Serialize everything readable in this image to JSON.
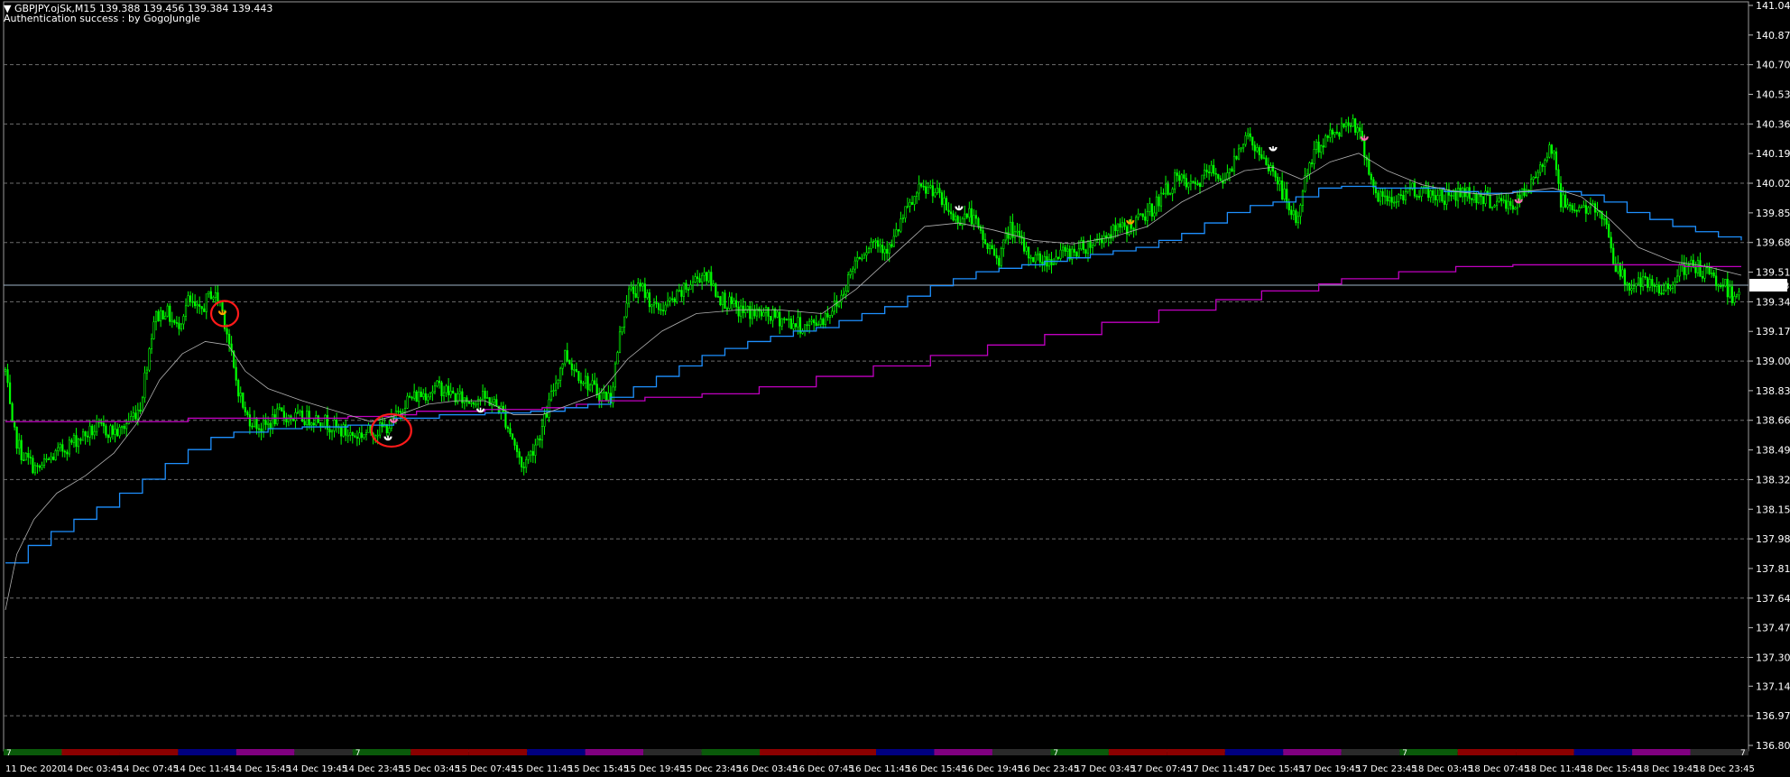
{
  "header": {
    "symbol_line": "GBPJPY.ojSk,M15  139.388 139.456 139.384 139.443",
    "status_line": "Authentication success : by GogoJungle"
  },
  "colors": {
    "background": "#000000",
    "grid": "#6e6e6e",
    "candles": "#00ff00",
    "blue_line": "#1e90ff",
    "magenta_line": "#c000c0",
    "ma_line": "#b0b0b0",
    "current_price_line": "#9fb3c8",
    "highlight_circle": "#ff1a1a"
  },
  "chart_data": {
    "type": "candlestick",
    "symbol": "GBPJPY.ojSk",
    "timeframe": "M15",
    "ylim": [
      136.803,
      141.048
    ],
    "y_ticks": [
      "141.048",
      "140.878",
      "140.708",
      "140.538",
      "140.368",
      "140.198",
      "140.028",
      "139.858",
      "139.688",
      "139.518",
      "139.348",
      "139.178",
      "139.008",
      "138.838",
      "138.668",
      "138.498",
      "138.328",
      "138.158",
      "137.988",
      "137.818",
      "137.648",
      "137.478",
      "137.308",
      "137.143",
      "136.973",
      "136.803"
    ],
    "current_price": "139.443",
    "ohlc_last": {
      "open": 139.388,
      "high": 139.456,
      "low": 139.384,
      "close": 139.443
    },
    "x_ticks": [
      "11 Dec 2020",
      "14 Dec 03:45",
      "14 Dec 07:45",
      "14 Dec 11:45",
      "14 Dec 15:45",
      "14 Dec 19:45",
      "14 Dec 23:45",
      "15 Dec 03:45",
      "15 Dec 07:45",
      "15 Dec 11:45",
      "15 Dec 15:45",
      "15 Dec 19:45",
      "15 Dec 23:45",
      "16 Dec 03:45",
      "16 Dec 07:45",
      "16 Dec 11:45",
      "16 Dec 15:45",
      "16 Dec 19:45",
      "16 Dec 23:45",
      "17 Dec 03:45",
      "17 Dec 07:45",
      "17 Dec 11:45",
      "17 Dec 15:45",
      "17 Dec 19:45",
      "17 Dec 23:45",
      "18 Dec 03:45",
      "18 Dec 07:45",
      "18 Dec 11:45",
      "18 Dec 15:45",
      "18 Dec 19:45",
      "18 Dec 23:45"
    ],
    "price_path": [
      [
        0,
        138.95
      ],
      [
        6,
        138.62
      ],
      [
        14,
        138.48
      ],
      [
        28,
        138.38
      ],
      [
        40,
        138.45
      ],
      [
        60,
        138.55
      ],
      [
        80,
        138.62
      ],
      [
        100,
        138.6
      ],
      [
        118,
        138.75
      ],
      [
        130,
        139.25
      ],
      [
        140,
        139.3
      ],
      [
        150,
        139.2
      ],
      [
        160,
        139.35
      ],
      [
        170,
        139.28
      ],
      [
        180,
        139.4
      ],
      [
        188,
        139.35
      ],
      [
        194,
        139.18
      ],
      [
        200,
        138.95
      ],
      [
        210,
        138.7
      ],
      [
        225,
        138.62
      ],
      [
        240,
        138.7
      ],
      [
        255,
        138.68
      ],
      [
        275,
        138.68
      ],
      [
        290,
        138.62
      ],
      [
        305,
        138.58
      ],
      [
        318,
        138.6
      ],
      [
        330,
        138.62
      ],
      [
        340,
        138.66
      ],
      [
        350,
        138.78
      ],
      [
        365,
        138.82
      ],
      [
        380,
        138.86
      ],
      [
        395,
        138.8
      ],
      [
        405,
        138.78
      ],
      [
        415,
        138.8
      ],
      [
        425,
        138.78
      ],
      [
        435,
        138.72
      ],
      [
        445,
        138.55
      ],
      [
        452,
        138.4
      ],
      [
        460,
        138.48
      ],
      [
        470,
        138.62
      ],
      [
        480,
        138.85
      ],
      [
        490,
        139.05
      ],
      [
        500,
        138.95
      ],
      [
        510,
        138.88
      ],
      [
        520,
        138.82
      ],
      [
        530,
        138.8
      ],
      [
        538,
        139.15
      ],
      [
        545,
        139.4
      ],
      [
        558,
        139.42
      ],
      [
        570,
        139.3
      ],
      [
        585,
        139.35
      ],
      [
        600,
        139.45
      ],
      [
        612,
        139.52
      ],
      [
        625,
        139.38
      ],
      [
        640,
        139.3
      ],
      [
        660,
        139.28
      ],
      [
        680,
        139.25
      ],
      [
        700,
        139.2
      ],
      [
        715,
        139.25
      ],
      [
        730,
        139.35
      ],
      [
        745,
        139.6
      ],
      [
        760,
        139.7
      ],
      [
        775,
        139.65
      ],
      [
        785,
        139.82
      ],
      [
        800,
        139.98
      ],
      [
        812,
        140.0
      ],
      [
        822,
        139.9
      ],
      [
        832,
        139.82
      ],
      [
        845,
        139.85
      ],
      [
        858,
        139.68
      ],
      [
        870,
        139.6
      ],
      [
        880,
        139.78
      ],
      [
        895,
        139.62
      ],
      [
        910,
        139.58
      ],
      [
        925,
        139.62
      ],
      [
        940,
        139.65
      ],
      [
        955,
        139.7
      ],
      [
        970,
        139.75
      ],
      [
        985,
        139.78
      ],
      [
        1000,
        139.85
      ],
      [
        1012,
        139.95
      ],
      [
        1025,
        140.05
      ],
      [
        1040,
        140.0
      ],
      [
        1055,
        140.1
      ],
      [
        1070,
        140.05
      ],
      [
        1080,
        140.25
      ],
      [
        1090,
        140.3
      ],
      [
        1100,
        140.15
      ],
      [
        1110,
        140.1
      ],
      [
        1120,
        139.95
      ],
      [
        1130,
        139.8
      ],
      [
        1140,
        140.1
      ],
      [
        1150,
        140.25
      ],
      [
        1160,
        140.3
      ],
      [
        1170,
        140.35
      ],
      [
        1180,
        140.4
      ],
      [
        1190,
        140.22
      ],
      [
        1200,
        139.95
      ],
      [
        1215,
        139.92
      ],
      [
        1230,
        140.0
      ],
      [
        1245,
        139.98
      ],
      [
        1260,
        139.95
      ],
      [
        1275,
        139.98
      ],
      [
        1290,
        139.95
      ],
      [
        1305,
        139.92
      ],
      [
        1320,
        139.9
      ],
      [
        1335,
        140.0
      ],
      [
        1345,
        140.15
      ],
      [
        1355,
        140.25
      ],
      [
        1362,
        139.92
      ],
      [
        1372,
        139.9
      ],
      [
        1385,
        139.88
      ],
      [
        1400,
        139.85
      ],
      [
        1410,
        139.55
      ],
      [
        1420,
        139.45
      ],
      [
        1435,
        139.45
      ],
      [
        1450,
        139.4
      ],
      [
        1465,
        139.52
      ],
      [
        1480,
        139.55
      ],
      [
        1495,
        139.48
      ],
      [
        1505,
        139.45
      ],
      [
        1512,
        139.38
      ],
      [
        1520,
        139.44
      ]
    ],
    "ma_path": [
      [
        0,
        137.58
      ],
      [
        10,
        137.9
      ],
      [
        25,
        138.1
      ],
      [
        45,
        138.25
      ],
      [
        70,
        138.35
      ],
      [
        95,
        138.48
      ],
      [
        115,
        138.65
      ],
      [
        135,
        138.9
      ],
      [
        155,
        139.05
      ],
      [
        175,
        139.12
      ],
      [
        195,
        139.1
      ],
      [
        210,
        138.95
      ],
      [
        230,
        138.85
      ],
      [
        260,
        138.78
      ],
      [
        290,
        138.72
      ],
      [
        320,
        138.66
      ],
      [
        345,
        138.7
      ],
      [
        370,
        138.76
      ],
      [
        395,
        138.78
      ],
      [
        420,
        138.78
      ],
      [
        445,
        138.7
      ],
      [
        470,
        138.7
      ],
      [
        495,
        138.76
      ],
      [
        520,
        138.82
      ],
      [
        545,
        139.02
      ],
      [
        575,
        139.18
      ],
      [
        605,
        139.28
      ],
      [
        640,
        139.3
      ],
      [
        680,
        139.3
      ],
      [
        715,
        139.28
      ],
      [
        745,
        139.42
      ],
      [
        775,
        139.6
      ],
      [
        805,
        139.78
      ],
      [
        835,
        139.8
      ],
      [
        865,
        139.76
      ],
      [
        900,
        139.7
      ],
      [
        935,
        139.68
      ],
      [
        970,
        139.72
      ],
      [
        1000,
        139.78
      ],
      [
        1030,
        139.92
      ],
      [
        1060,
        140.02
      ],
      [
        1085,
        140.1
      ],
      [
        1110,
        140.12
      ],
      [
        1135,
        140.05
      ],
      [
        1160,
        140.15
      ],
      [
        1185,
        140.2
      ],
      [
        1210,
        140.1
      ],
      [
        1240,
        140.02
      ],
      [
        1270,
        139.98
      ],
      [
        1300,
        139.96
      ],
      [
        1330,
        139.98
      ],
      [
        1355,
        140.0
      ],
      [
        1380,
        139.95
      ],
      [
        1405,
        139.82
      ],
      [
        1430,
        139.66
      ],
      [
        1460,
        139.58
      ],
      [
        1490,
        139.55
      ],
      [
        1520,
        139.5
      ]
    ],
    "blue_steps": [
      [
        0,
        137.85
      ],
      [
        20,
        137.95
      ],
      [
        40,
        138.03
      ],
      [
        60,
        138.1
      ],
      [
        80,
        138.17
      ],
      [
        100,
        138.25
      ],
      [
        120,
        138.33
      ],
      [
        140,
        138.42
      ],
      [
        160,
        138.5
      ],
      [
        180,
        138.57
      ],
      [
        200,
        138.6
      ],
      [
        230,
        138.62
      ],
      [
        260,
        138.63
      ],
      [
        300,
        138.64
      ],
      [
        340,
        138.68
      ],
      [
        380,
        138.7
      ],
      [
        420,
        138.71
      ],
      [
        460,
        138.72
      ],
      [
        490,
        138.74
      ],
      [
        510,
        138.76
      ],
      [
        530,
        138.8
      ],
      [
        550,
        138.86
      ],
      [
        570,
        138.92
      ],
      [
        590,
        138.98
      ],
      [
        610,
        139.04
      ],
      [
        630,
        139.08
      ],
      [
        650,
        139.12
      ],
      [
        670,
        139.15
      ],
      [
        690,
        139.18
      ],
      [
        710,
        139.2
      ],
      [
        730,
        139.24
      ],
      [
        750,
        139.28
      ],
      [
        770,
        139.32
      ],
      [
        790,
        139.38
      ],
      [
        810,
        139.44
      ],
      [
        830,
        139.48
      ],
      [
        850,
        139.52
      ],
      [
        870,
        139.54
      ],
      [
        890,
        139.56
      ],
      [
        910,
        139.58
      ],
      [
        930,
        139.6
      ],
      [
        950,
        139.62
      ],
      [
        970,
        139.64
      ],
      [
        990,
        139.66
      ],
      [
        1010,
        139.7
      ],
      [
        1030,
        139.74
      ],
      [
        1050,
        139.8
      ],
      [
        1070,
        139.86
      ],
      [
        1090,
        139.9
      ],
      [
        1110,
        139.92
      ],
      [
        1130,
        139.95
      ],
      [
        1150,
        140.0
      ],
      [
        1170,
        140.01
      ],
      [
        1200,
        140.0
      ],
      [
        1230,
        140.0
      ],
      [
        1260,
        139.98
      ],
      [
        1290,
        139.97
      ],
      [
        1320,
        139.98
      ],
      [
        1350,
        139.98
      ],
      [
        1380,
        139.96
      ],
      [
        1400,
        139.92
      ],
      [
        1420,
        139.86
      ],
      [
        1440,
        139.82
      ],
      [
        1460,
        139.78
      ],
      [
        1480,
        139.75
      ],
      [
        1500,
        139.72
      ],
      [
        1520,
        139.7
      ]
    ],
    "magenta_steps": [
      [
        0,
        138.66
      ],
      [
        100,
        138.66
      ],
      [
        160,
        138.68
      ],
      [
        220,
        138.68
      ],
      [
        300,
        138.69
      ],
      [
        340,
        138.7
      ],
      [
        360,
        138.72
      ],
      [
        420,
        138.73
      ],
      [
        470,
        138.74
      ],
      [
        500,
        138.76
      ],
      [
        520,
        138.78
      ],
      [
        560,
        138.8
      ],
      [
        610,
        138.82
      ],
      [
        660,
        138.86
      ],
      [
        710,
        138.92
      ],
      [
        760,
        138.98
      ],
      [
        810,
        139.04
      ],
      [
        860,
        139.1
      ],
      [
        910,
        139.16
      ],
      [
        960,
        139.23
      ],
      [
        1010,
        139.3
      ],
      [
        1060,
        139.36
      ],
      [
        1100,
        139.41
      ],
      [
        1150,
        139.45
      ],
      [
        1170,
        139.48
      ],
      [
        1220,
        139.52
      ],
      [
        1270,
        139.55
      ],
      [
        1320,
        139.56
      ],
      [
        1380,
        139.56
      ],
      [
        1420,
        139.56
      ],
      [
        1470,
        139.55
      ],
      [
        1520,
        139.55
      ]
    ],
    "signals": [
      {
        "i": 190,
        "price": 139.28,
        "color": "#ffa000"
      },
      {
        "i": 340,
        "price": 138.66,
        "color": "#ff69b4"
      },
      {
        "i": 335,
        "price": 138.56,
        "color": "#ffffff"
      },
      {
        "i": 416,
        "price": 138.72,
        "color": "#ffffff"
      },
      {
        "i": 835,
        "price": 139.88,
        "color": "#ffffff"
      },
      {
        "i": 985,
        "price": 139.8,
        "color": "#ffa000"
      },
      {
        "i": 1110,
        "price": 140.22,
        "color": "#ffffff"
      },
      {
        "i": 1190,
        "price": 140.28,
        "color": "#ff69b4"
      },
      {
        "i": 1325,
        "price": 139.92,
        "color": "#ff69b4"
      }
    ],
    "circles": [
      {
        "i": 192,
        "price": 139.28
      },
      {
        "i": 338,
        "price": 138.61
      }
    ],
    "session_bar": {
      "label": "7",
      "segments": [
        "#0a5a0a",
        "#8b0000",
        "#8b0000",
        "#000080",
        "#800080",
        "#2a2a2a",
        "#0a5a0a",
        "#8b0000",
        "#8b0000",
        "#000080",
        "#800080",
        "#2a2a2a",
        "#0a5a0a",
        "#8b0000",
        "#8b0000",
        "#000080",
        "#800080",
        "#2a2a2a",
        "#0a5a0a",
        "#8b0000",
        "#8b0000",
        "#000080",
        "#800080",
        "#2a2a2a",
        "#0a5a0a",
        "#8b0000",
        "#8b0000",
        "#000080",
        "#800080",
        "#2a2a2a"
      ]
    }
  }
}
